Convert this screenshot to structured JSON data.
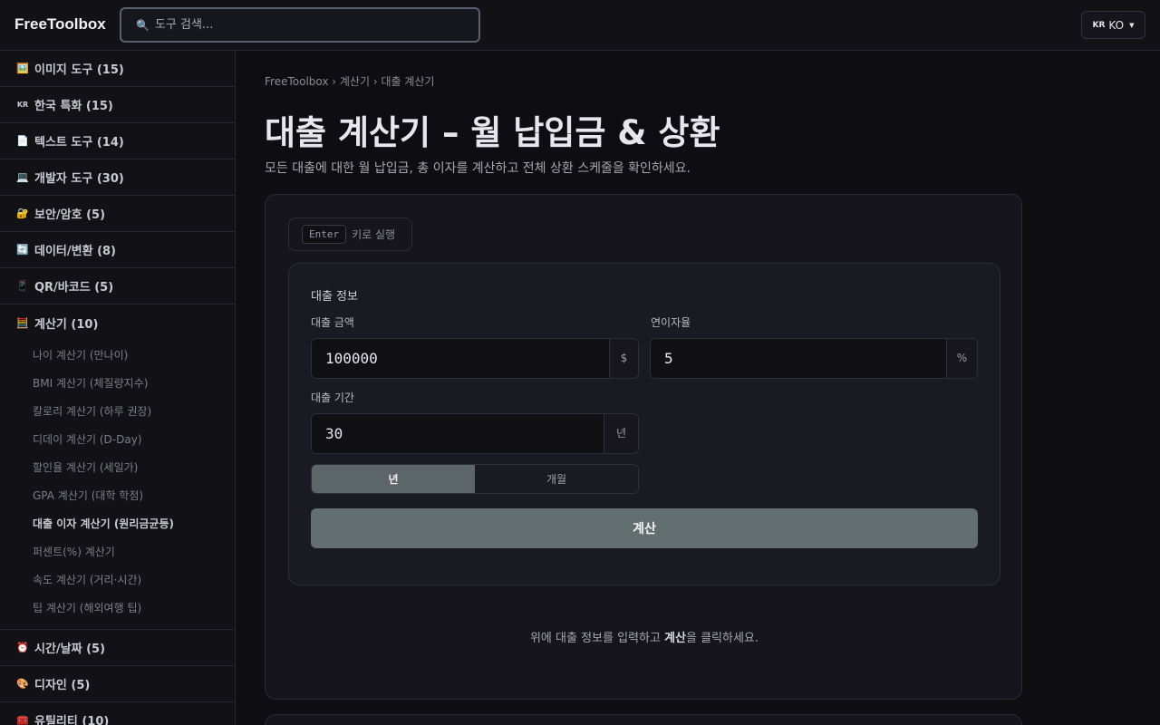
{
  "header": {
    "logo": "FreeToolbox",
    "search_placeholder": "도구 검색...",
    "lang_flag": "KR",
    "lang_label": "KO"
  },
  "sidebar": {
    "categories_top": [
      {
        "icon": "🖼️",
        "label": "이미지 도구 (15)"
      },
      {
        "icon": "KR",
        "label": "한국 특화 (15)"
      },
      {
        "icon": "📄",
        "label": "텍스트 도구 (14)"
      },
      {
        "icon": "💻",
        "label": "개발자 도구 (30)"
      },
      {
        "icon": "🔐",
        "label": "보안/암호 (5)"
      },
      {
        "icon": "🔄",
        "label": "데이터/변환 (8)"
      },
      {
        "icon": "📱",
        "label": "QR/바코드 (5)"
      }
    ],
    "open_category": {
      "icon": "🧮",
      "label": "계산기 (10)"
    },
    "sub_items": [
      "나이 계산기 (만나이)",
      "BMI 계산기 (체질량지수)",
      "칼로리 계산기 (하루 권장)",
      "디데이 계산기 (D-Day)",
      "할인율 계산기 (세일가)",
      "GPA 계산기 (대학 학점)",
      "대출 이자 계산기 (원리금균등)",
      "퍼센트(%) 계산기",
      "속도 계산기 (거리·시간)",
      "팁 계산기 (해외여행 팁)"
    ],
    "active_sub_index": 6,
    "categories_bottom": [
      {
        "icon": "⏰",
        "label": "시간/날짜 (5)"
      },
      {
        "icon": "🎨",
        "label": "디자인 (5)"
      },
      {
        "icon": "🧰",
        "label": "유틸리티 (10)"
      }
    ]
  },
  "main": {
    "breadcrumb": "FreeToolbox › 계산기 › 대출 계산기",
    "title": "대출 계산기 – 월 납입금 & 상환",
    "subtitle": "모든 대출에 대한 월 납입금, 총 이자를 계산하고 전체 상환 스케줄을 확인하세요.",
    "enter_key": "Enter",
    "enter_hint": "키로 실행",
    "form": {
      "section_title": "대출 정보",
      "amount_label": "대출 금액",
      "amount_value": "100000",
      "amount_suffix": "$",
      "rate_label": "연이자율",
      "rate_value": "5",
      "rate_suffix": "%",
      "term_label": "대출 기간",
      "term_value": "30",
      "term_suffix": "년",
      "toggle_years": "년",
      "toggle_months": "개월",
      "calc_button": "계산"
    },
    "hint_prefix": "위에 대출 정보를 입력하고 ",
    "hint_bold": "계산",
    "hint_suffix": "을 클릭하세요."
  }
}
